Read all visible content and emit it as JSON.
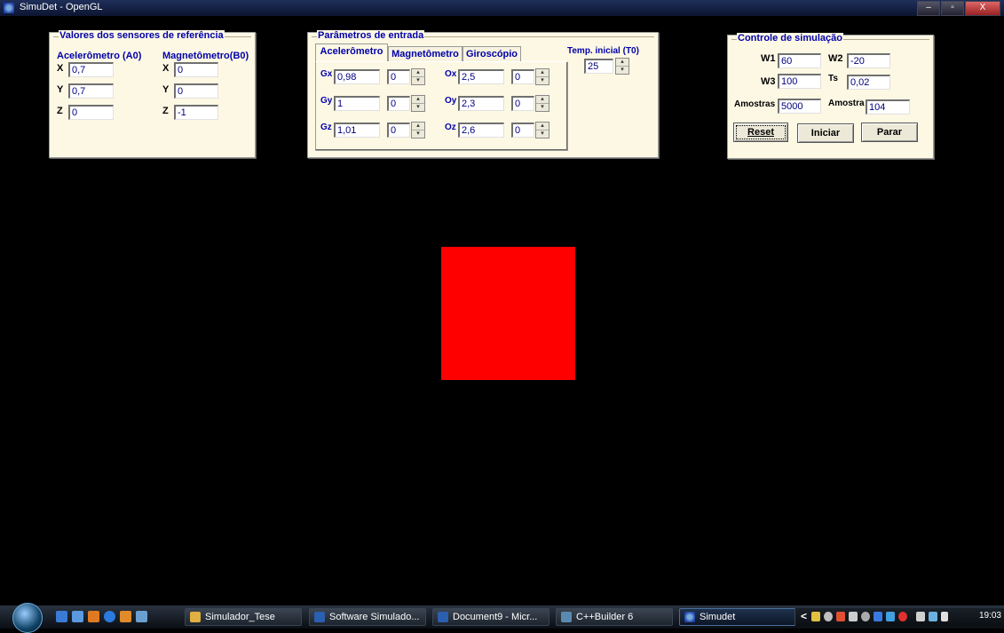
{
  "window": {
    "title": "SimuDet - OpenGL",
    "controls": [
      "–",
      "▫",
      "X"
    ]
  },
  "sensors": {
    "title": "Valores dos sensores de referência",
    "accel_label": "Acelerômetro (A0)",
    "mag_label": "Magnetômetro(B0)",
    "axes": [
      "X",
      "Y",
      "Z"
    ],
    "accel_values": [
      "0,7",
      "0,7",
      "0"
    ],
    "mag_values": [
      "0",
      "0",
      "-1"
    ]
  },
  "params": {
    "title": "Parâmetros de entrada",
    "tabs": [
      "Acelerômetro",
      "Magnetômetro",
      "Giroscópio"
    ],
    "active_tab": "Acelerômetro",
    "g_labels": [
      "Gx",
      "Gy",
      "Gz"
    ],
    "g_values": [
      "0,98",
      "1",
      "1,01"
    ],
    "g_spins": [
      "0",
      "0",
      "0"
    ],
    "o_labels": [
      "Ox",
      "Oy",
      "Oz"
    ],
    "o_values": [
      "2,5",
      "2,3",
      "2,6"
    ],
    "o_spins": [
      "0",
      "0",
      "0"
    ],
    "temp_label": "Temp. inicial (T0)",
    "temp_value": "25"
  },
  "control": {
    "title": "Controle de simulação",
    "w1_label": "W1",
    "w1_value": "60",
    "w2_label": "W2",
    "w2_value": "-20",
    "w3_label": "W3",
    "w3_value": "100",
    "ts_label": "Ts",
    "ts_value": "0,02",
    "amostras_label": "Amostras",
    "amostras_value": "5000",
    "amostra_label": "Amostra",
    "amostra_value": "104",
    "buttons": [
      "Reset",
      "Iniciar",
      "Parar"
    ]
  },
  "scene": {
    "square_color": "#ff0000"
  },
  "taskbar": {
    "items": [
      {
        "label": "Simulador_Tese",
        "icon": "folder-icon"
      },
      {
        "label": "Software Simulado...",
        "icon": "word-icon"
      },
      {
        "label": "Document9 - Micr...",
        "icon": "word-icon"
      },
      {
        "label": "C++Builder 6",
        "icon": "builder-icon"
      },
      {
        "label": "Simudet",
        "icon": "app-icon"
      }
    ],
    "tray_chevron": "<",
    "clock": "19:03"
  }
}
